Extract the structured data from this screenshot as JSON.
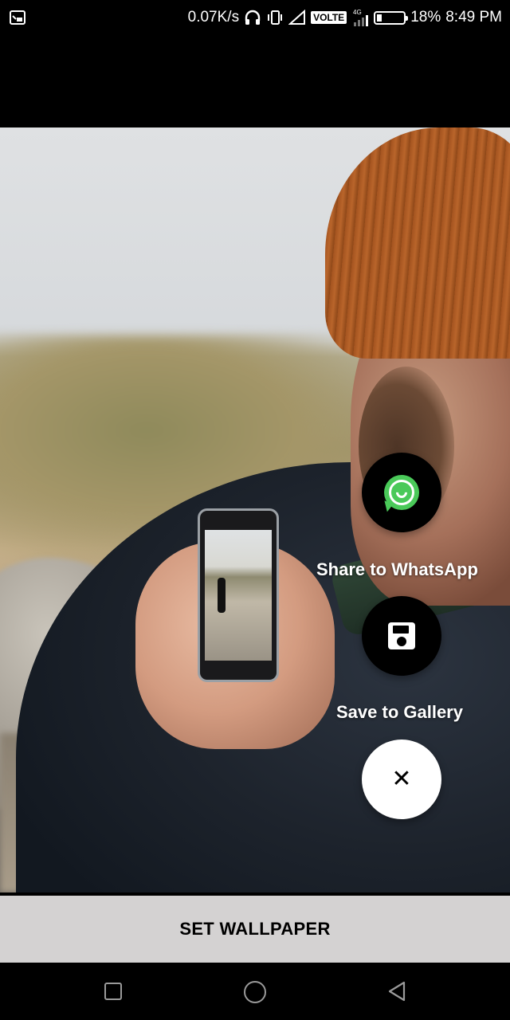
{
  "status_bar": {
    "network_speed": "0.07K/s",
    "volte": "VOLTE",
    "network_type": "4G",
    "battery": "18%",
    "battery_level": 0.18,
    "time": "8:49 PM"
  },
  "fab_menu": {
    "whatsapp_label": "Share to WhatsApp",
    "save_label": "Save to Gallery",
    "close_symbol": "✕"
  },
  "bottom": {
    "set_wallpaper_label": "SET WALLPAPER"
  },
  "colors": {
    "whatsapp_green": "#4ac959",
    "fab_dark": "#000000",
    "fab_light": "#ffffff",
    "button_bar": "#d4d2d2"
  },
  "icons": {
    "status_left": "screencast-icon",
    "whatsapp": "whatsapp-icon",
    "save": "floppy-disk-icon",
    "close": "close-icon",
    "nav": [
      "recents-square-icon",
      "home-circle-icon",
      "back-triangle-icon"
    ]
  }
}
